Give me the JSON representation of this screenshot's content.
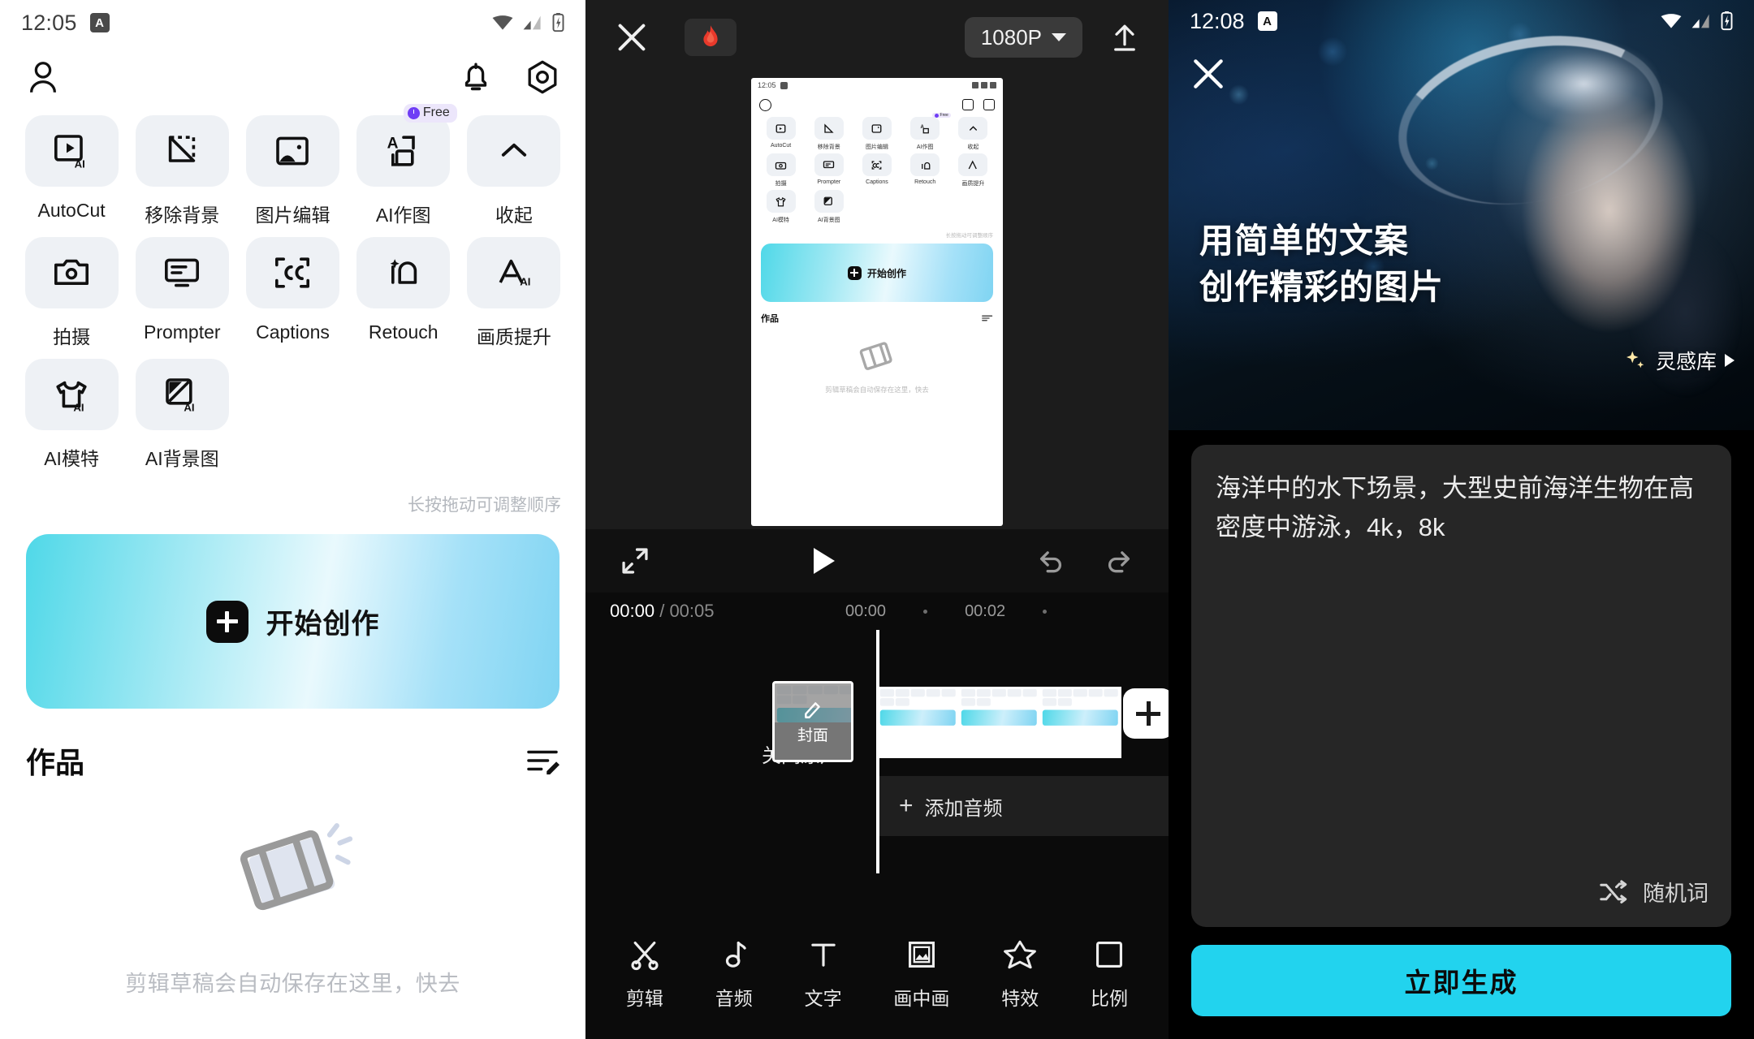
{
  "panel1": {
    "status": {
      "time": "12:05",
      "badge": "A",
      "icons": [
        "wifi-icon",
        "signal-icon",
        "battery-charging-icon"
      ]
    },
    "topbar": {
      "profile_icon": "person-icon",
      "bell_icon": "bell-icon",
      "settings_icon": "gear-icon"
    },
    "tools": [
      {
        "label": "AutoCut",
        "icon": "autocut-ai-icon",
        "badge": null
      },
      {
        "label": "移除背景",
        "icon": "remove-background-icon",
        "badge": null
      },
      {
        "label": "图片编辑",
        "icon": "image-edit-icon",
        "badge": null
      },
      {
        "label": "AI作图",
        "icon": "ai-image-gen-icon",
        "badge": "Free"
      },
      {
        "label": "收起",
        "icon": "chevron-up-icon",
        "badge": null
      },
      {
        "label": "拍摄",
        "icon": "camera-icon",
        "badge": null
      },
      {
        "label": "Prompter",
        "icon": "prompter-icon",
        "badge": null
      },
      {
        "label": "Captions",
        "icon": "captions-icon",
        "badge": null
      },
      {
        "label": "Retouch",
        "icon": "retouch-icon",
        "badge": null
      },
      {
        "label": "画质提升",
        "icon": "quality-enhance-icon",
        "badge": null
      },
      {
        "label": "AI模特",
        "icon": "ai-model-shirt-icon",
        "badge": null
      },
      {
        "label": "AI背景图",
        "icon": "ai-background-icon",
        "badge": null
      }
    ],
    "drag_hint": "长按拖动可调整顺序",
    "create_button": "开始创作",
    "works": {
      "title": "作品",
      "manage_icon": "edit-list-icon"
    },
    "empty": {
      "icon": "film-strip-icon",
      "text": "剪辑草稿会自动保存在这里，快去"
    }
  },
  "panel2": {
    "topbar": {
      "close_icon": "close-icon",
      "flame_icon": "flame-icon",
      "resolution": "1080P",
      "resolution_caret": "chevron-down-icon",
      "export_icon": "upload-icon"
    },
    "preview_mock": {
      "status_time": "12:05",
      "tools": [
        {
          "label": "AutoCut",
          "badge": null
        },
        {
          "label": "移除背景",
          "badge": null
        },
        {
          "label": "图片编辑",
          "badge": null
        },
        {
          "label": "AI作图",
          "badge": "Free"
        },
        {
          "label": "收起",
          "badge": null
        },
        {
          "label": "拍摄",
          "badge": null
        },
        {
          "label": "Prompter",
          "badge": null
        },
        {
          "label": "Captions",
          "badge": null
        },
        {
          "label": "Retouch",
          "badge": null
        },
        {
          "label": "画质提升",
          "badge": null
        },
        {
          "label": "AI模特",
          "badge": null
        },
        {
          "label": "AI背景图",
          "badge": null
        }
      ],
      "drag_hint": "长按拖动可调整顺序",
      "create_button": "开始创作",
      "works_title": "作品",
      "empty_text": "剪辑草稿会自动保存在这里，快去"
    },
    "controls": {
      "fullscreen_icon": "expand-icon",
      "play_icon": "play-icon",
      "undo_icon": "undo-icon",
      "redo_icon": "redo-icon"
    },
    "timeline": {
      "current_time": "00:00",
      "separator": "/",
      "total_time": "00:05",
      "ruler": [
        "00:00",
        "00:02"
      ],
      "mute_label": "关闭原声",
      "mute_icon": "speaker-mute-icon",
      "cover_label": "封面",
      "cover_edit_icon": "pencil-icon",
      "add_clip_icon": "plus-icon",
      "add_audio_label": "添加音频",
      "add_audio_icon": "plus-icon"
    },
    "bottombar": [
      {
        "label": "剪辑",
        "icon": "scissors-icon"
      },
      {
        "label": "音频",
        "icon": "music-note-icon"
      },
      {
        "label": "文字",
        "icon": "text-t-icon"
      },
      {
        "label": "画中画",
        "icon": "picture-in-picture-icon"
      },
      {
        "label": "特效",
        "icon": "sparkle-star-icon"
      },
      {
        "label": "比例",
        "icon": "ratio-square-icon"
      }
    ]
  },
  "panel3": {
    "status": {
      "time": "12:08",
      "badge": "A",
      "icons": [
        "wifi-icon",
        "signal-icon",
        "battery-charging-icon"
      ]
    },
    "close_icon": "close-icon",
    "hero": {
      "title_line1": "用简单的文案",
      "title_line2": "创作精彩的图片",
      "inspiration_label": "灵感库",
      "inspiration_icon": "sparkle-icon",
      "inspiration_chevron": "chevron-right-icon"
    },
    "prompt": {
      "text": "海洋中的水下场景，大型史前海洋生物在高密度中游泳，4k，8k",
      "random_label": "随机词",
      "random_icon": "shuffle-icon"
    },
    "generate_button": "立即生成",
    "accent_color": "#22d3ee"
  }
}
